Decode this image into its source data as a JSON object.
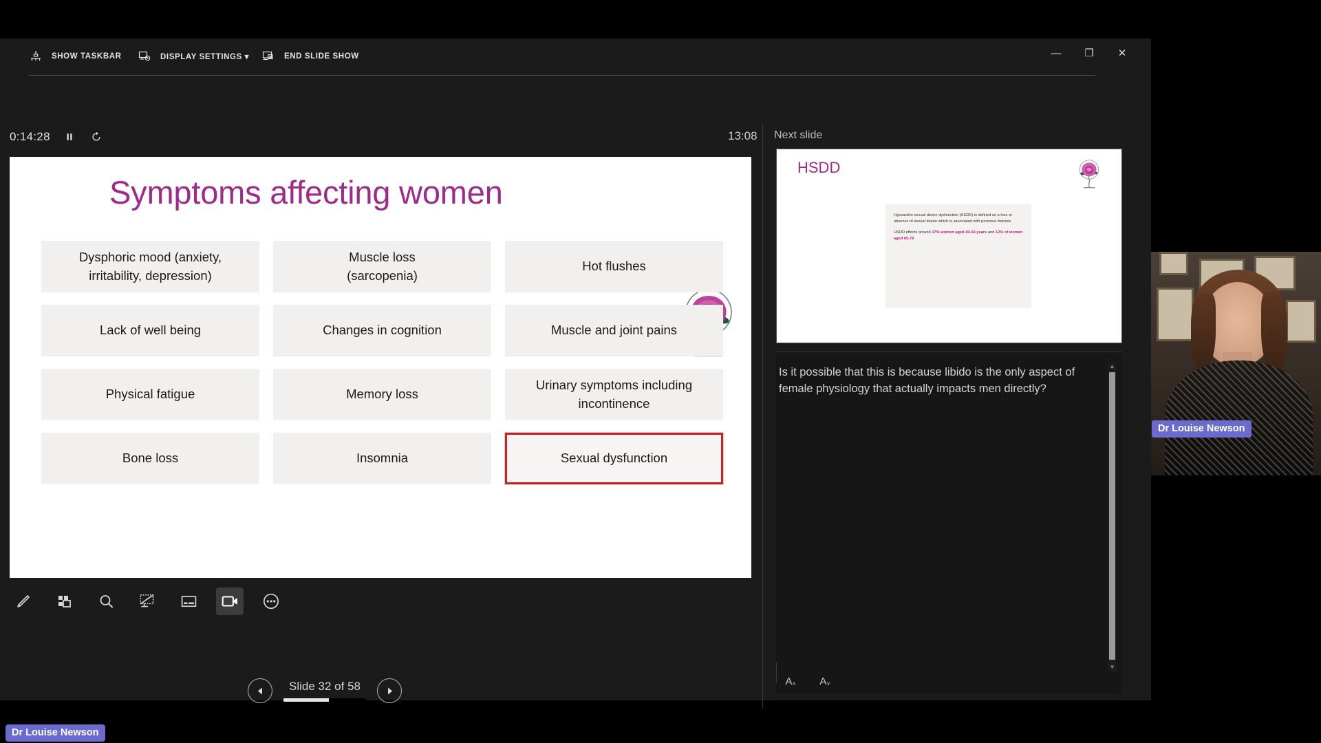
{
  "commandbar": {
    "show_taskbar": "SHOW TASKBAR",
    "display_settings": "DISPLAY SETTINGS ▾",
    "end_slide_show": "END SLIDE SHOW",
    "minimize": "—",
    "restore": "❐",
    "close": "✕"
  },
  "status": {
    "timer": "0:14:28",
    "clock": "13:08",
    "next_slide_label": "Next slide"
  },
  "slide": {
    "title": "Symptoms affecting women",
    "title_color": "#9e2a8c",
    "symptoms": [
      {
        "text": "Dysphoric mood (anxiety, irritability, depression)",
        "highlighted": false
      },
      {
        "text": "Muscle loss\n(sarcopenia)",
        "highlighted": false
      },
      {
        "text": "Hot flushes",
        "highlighted": false
      },
      {
        "text": "Lack of well being",
        "highlighted": false
      },
      {
        "text": "Changes in cognition",
        "highlighted": false
      },
      {
        "text": "Muscle and joint pains",
        "highlighted": false
      },
      {
        "text": "Physical fatigue",
        "highlighted": false
      },
      {
        "text": "Memory loss",
        "highlighted": false
      },
      {
        "text": "Urinary symptoms including incontinence",
        "highlighted": false
      },
      {
        "text": "Bone loss",
        "highlighted": false
      },
      {
        "text": "Insomnia",
        "highlighted": false
      },
      {
        "text": "Sexual dysfunction",
        "highlighted": true
      }
    ],
    "highlight_color": "#c0252a"
  },
  "navigation": {
    "previous": "◀",
    "next": "▶",
    "counter": "Slide 32 of 58",
    "progress_percent": 55
  },
  "toolbar": {
    "items": [
      {
        "icon": "pen-icon",
        "active": false
      },
      {
        "icon": "all-slides-icon",
        "active": false
      },
      {
        "icon": "zoom-in-icon",
        "active": false
      },
      {
        "icon": "blank-screen-icon",
        "active": false
      },
      {
        "icon": "subtitles-icon",
        "active": false
      },
      {
        "icon": "camera-icon",
        "active": true
      },
      {
        "icon": "more-options-icon",
        "active": false
      }
    ]
  },
  "preview": {
    "title": "HSDD",
    "body_paragraph_1": "Hypoactive sexual desire dysfunction (HSDD) is defined as a loss or absence of sexual desire which is associated with personal distress",
    "body_paragraph_2_pre": "HSDD effects around ",
    "body_stat_1": "37% women aged 40-64 years",
    "body_paragraph_2_mid": " and ",
    "body_stat_2": "12% of women aged 65-79",
    "stat_color": "#c0187f"
  },
  "notes": {
    "text": "Is it possible that this is because libido is the only aspect of female physiology that actually impacts men directly?",
    "increase_font": "A",
    "decrease_font": "A"
  },
  "participant": {
    "name": "Dr Louise Newson",
    "badge_color": "#6b6bcf"
  },
  "taskbar": {
    "name": "Dr Louise Newson"
  }
}
